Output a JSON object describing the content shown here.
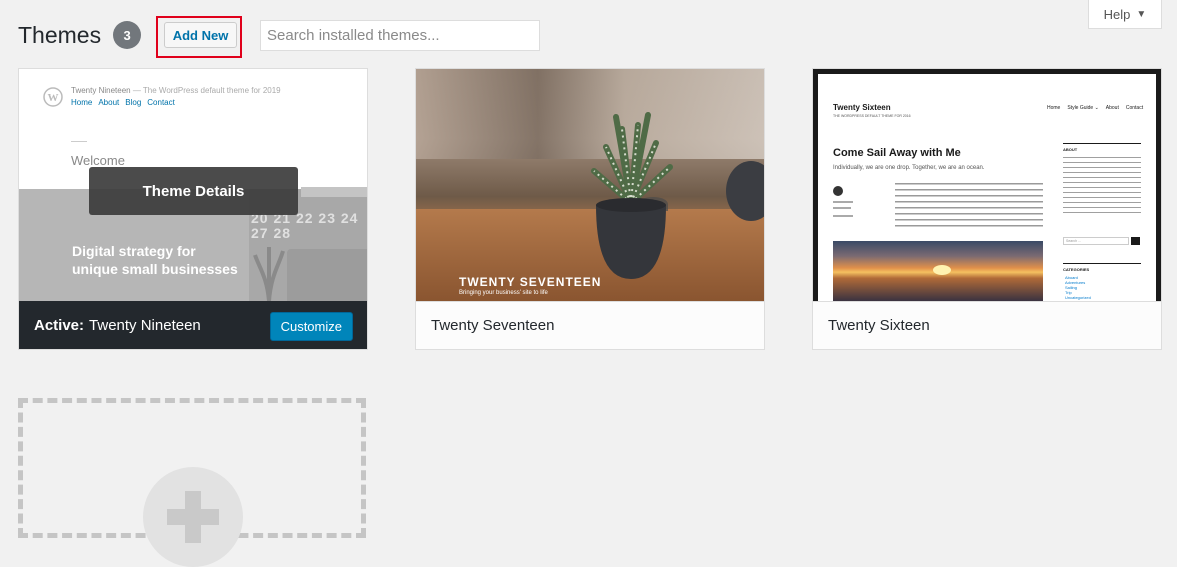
{
  "header": {
    "title": "Themes",
    "count": "3",
    "add_new_label": "Add New",
    "search_placeholder": "Search installed themes...",
    "help_label": "Help"
  },
  "themes": [
    {
      "name": "Twenty Nineteen",
      "active_prefix": "Active:",
      "customize_label": "Customize",
      "details_label": "Theme Details",
      "preview": {
        "site_title": "Twenty Nineteen",
        "tagline": "— The WordPress default theme for 2019",
        "nav": [
          "Home",
          "About",
          "Blog",
          "Contact"
        ],
        "heading": "Welcome",
        "hero_line1": "Digital strategy for",
        "hero_line2": "unique small businesses",
        "calendar": [
          "20",
          "21",
          "22",
          "23",
          "24",
          "27",
          "28"
        ]
      }
    },
    {
      "name": "Twenty Seventeen",
      "preview": {
        "site_title": "TWENTY SEVENTEEN",
        "tagline": "Bringing your business' site to life"
      }
    },
    {
      "name": "Twenty Sixteen",
      "preview": {
        "site_title": "Twenty Sixteen",
        "tagline": "THE WORDPRESS DEFAULT THEME FOR 2016",
        "nav": [
          "Home",
          "Style Guide ⌄",
          "About",
          "Contact"
        ],
        "post_title": "Come Sail Away with Me",
        "post_intro": "Individually, we are one drop. Together, we are an ocean.",
        "sidebar_about": "ABOUT",
        "sidebar_search": "Search ...",
        "sidebar_categories": "CATEGORIES",
        "categories": [
          "Aboard",
          "Adventures",
          "Sailing",
          "Trip",
          "Uncategorized"
        ]
      }
    }
  ],
  "colors": {
    "accent": "#0073aa",
    "primary_button": "#0085ba",
    "highlight": "#e0001b"
  },
  "icons": {
    "wordpress": "wordpress-icon",
    "help_arrow": "caret-down-icon",
    "add": "plus-icon"
  }
}
